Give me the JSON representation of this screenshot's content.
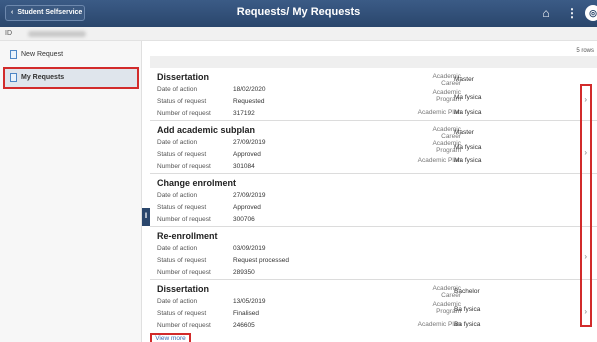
{
  "header": {
    "back_label": "Student Selfservice",
    "title": "Requests/ My Requests"
  },
  "id_row": {
    "label": "ID"
  },
  "sidebar": {
    "items": [
      {
        "label": "New Request"
      },
      {
        "label": "My Requests",
        "selected": true
      }
    ]
  },
  "list": {
    "rows_count": "5 rows",
    "field_labels": {
      "date": "Date of action",
      "status": "Status of request",
      "number": "Number of request",
      "career_1": "Academic",
      "career_2": "Career",
      "program_1": "Academic",
      "program_2": "Program",
      "plan": "Academic Plan"
    },
    "items": [
      {
        "title": "Dissertation",
        "date": "18/02/2020",
        "status": "Requested",
        "number": "317192",
        "career": "Master",
        "program": "Ma fysica",
        "plan": "Ma fysica"
      },
      {
        "title": "Add academic subplan",
        "date": "27/09/2019",
        "status": "Approved",
        "number": "301084",
        "career": "Master",
        "program": "Ma fysica",
        "plan": "Ma fysica"
      },
      {
        "title": "Change enrolment",
        "date": "27/09/2019",
        "status": "Approved",
        "number": "300706"
      },
      {
        "title": "Re-enrollment",
        "date": "03/09/2019",
        "status": "Request processed",
        "number": "289350"
      },
      {
        "title": "Dissertation",
        "date": "13/05/2019",
        "status": "Finalised",
        "number": "246605",
        "career": "Bachelor",
        "program": "Ba fysica",
        "plan": "Ba fysica"
      }
    ],
    "view_more": "View more"
  },
  "colors": {
    "header": "#2a466c",
    "highlight": "#d22b2b",
    "link": "#3a6bb0"
  }
}
